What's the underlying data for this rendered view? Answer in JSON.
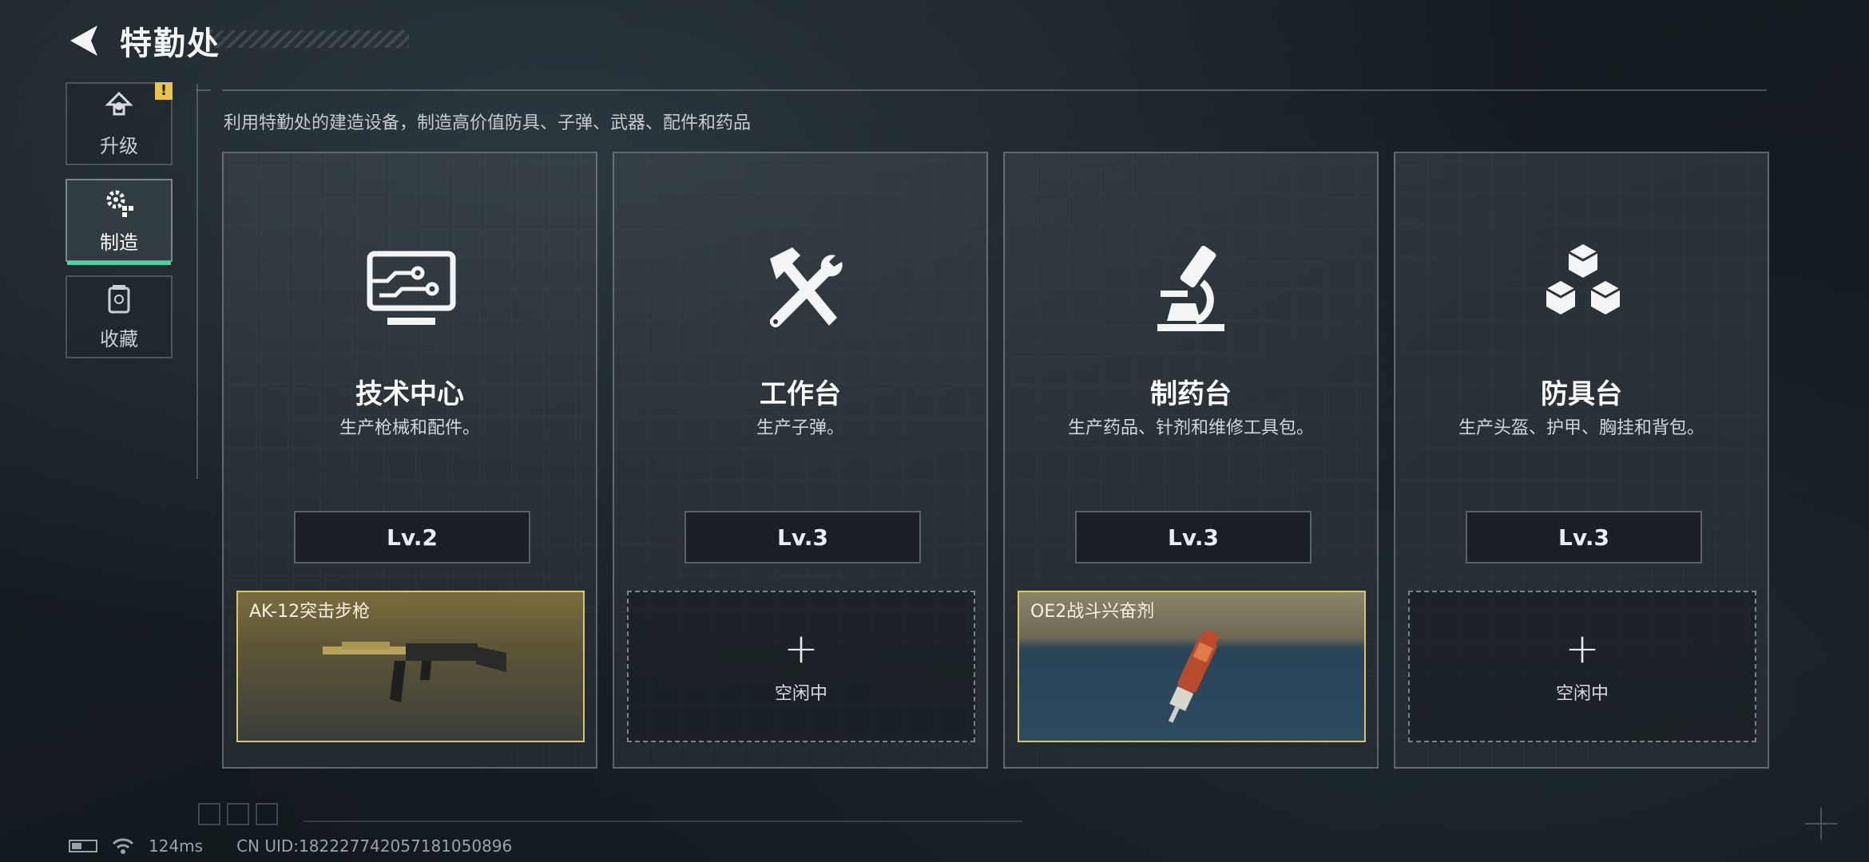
{
  "header": {
    "title": "特勤处"
  },
  "sidebar": {
    "items": [
      {
        "label": "升级",
        "icon": "upgrade-icon",
        "alert": "!"
      },
      {
        "label": "制造",
        "icon": "craft-gears-icon"
      },
      {
        "label": "收藏",
        "icon": "collection-icon"
      }
    ],
    "active_color": "#3ddc97"
  },
  "main": {
    "description": "利用特勤处的建造设备，制造高价值防具、子弹、武器、配件和药品",
    "stations": [
      {
        "title": "技术中心",
        "desc": "生产枪械和配件。",
        "level": "Lv.2",
        "icon": "monitor-circuit-icon",
        "slot": {
          "state": "busy",
          "item": "AK-12突击步枪",
          "item_icon": "rifle-icon"
        }
      },
      {
        "title": "工作台",
        "desc": "生产子弹。",
        "level": "Lv.3",
        "icon": "hammer-wrench-icon",
        "slot": {
          "state": "idle",
          "plus": "+",
          "label": "空闲中"
        }
      },
      {
        "title": "制药台",
        "desc": "生产药品、针剂和维修工具包。",
        "level": "Lv.3",
        "icon": "microscope-icon",
        "slot": {
          "state": "busy",
          "item": "OE2战斗兴奋剂",
          "item_icon": "syringe-icon"
        }
      },
      {
        "title": "防具台",
        "desc": "生产头盔、护甲、胸挂和背包。",
        "level": "Lv.3",
        "icon": "boxes-icon",
        "slot": {
          "state": "idle",
          "plus": "+",
          "label": "空闲中"
        }
      }
    ],
    "slot_border_color": "#d8c66a"
  },
  "footer": {
    "ping": "124ms",
    "uid": "CN UID:18222774205718105​0896"
  }
}
